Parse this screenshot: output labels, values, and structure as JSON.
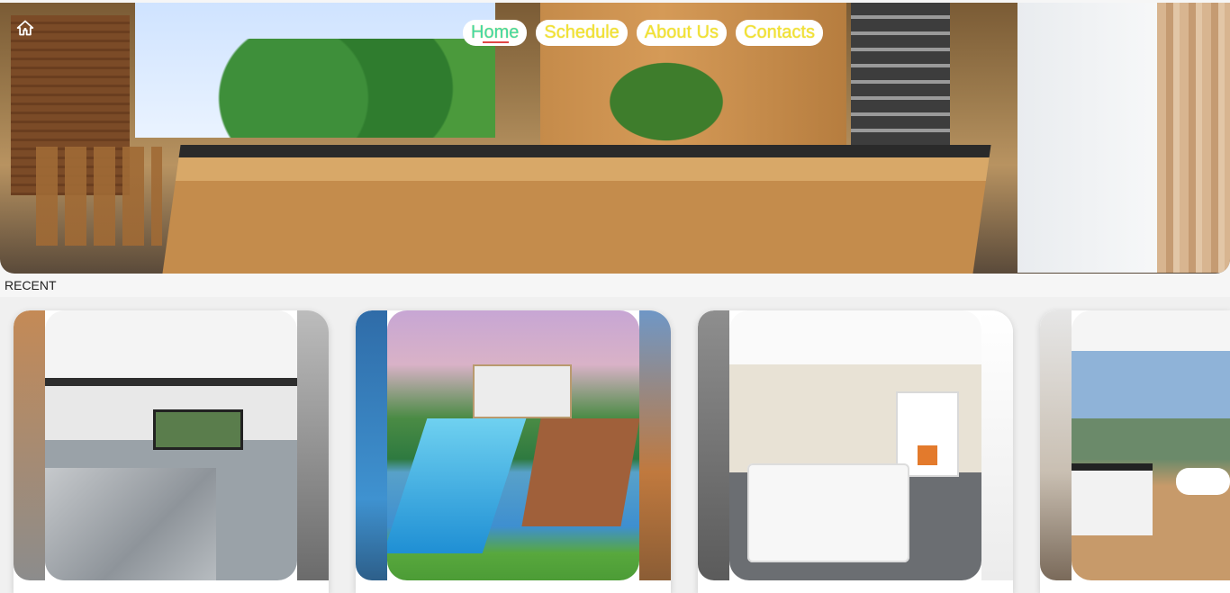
{
  "nav": {
    "home_icon": "home-icon",
    "items": [
      {
        "label": "Home",
        "active": true
      },
      {
        "label": "Schedule",
        "active": false
      },
      {
        "label": "About Us",
        "active": false
      },
      {
        "label": "Contacts",
        "active": false
      }
    ],
    "active_color": "#3fd9a8",
    "inactive_color": "#f2e233",
    "underline_color": "#e04646"
  },
  "hero": {
    "image": "kitchen-hero-image"
  },
  "recent": {
    "label": "RECENT",
    "cards": [
      {
        "image": "kitchen-marble-island-image"
      },
      {
        "image": "villa-infinity-pool-image"
      },
      {
        "image": "master-bedroom-fireplace-image"
      },
      {
        "image": "bathroom-ocean-view-image"
      }
    ]
  }
}
